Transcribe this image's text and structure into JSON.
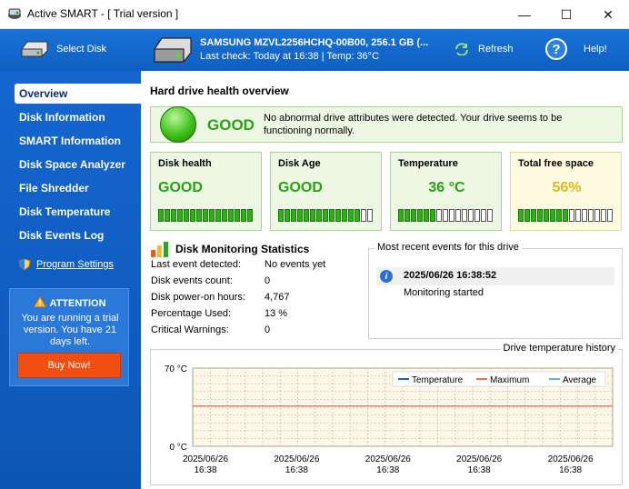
{
  "window": {
    "title": "Active SMART - [ Trial version ]",
    "controls": {
      "minimize": "—",
      "maximize": "☐",
      "close": "✕"
    }
  },
  "toolbar": {
    "select_disk": "Select Disk",
    "drive_name": "SAMSUNG MZVL2256HCHQ-00B00, 256.1 GB (...",
    "drive_check": "Last check: Today at 16:38 | Temp: 36°C",
    "refresh": "Refresh",
    "help": "Help!",
    "help_glyph": "?"
  },
  "sidebar": {
    "items": [
      {
        "label": "Overview",
        "active": true
      },
      {
        "label": "Disk Information"
      },
      {
        "label": "SMART Information"
      },
      {
        "label": "Disk Space Analyzer"
      },
      {
        "label": "File Shredder"
      },
      {
        "label": "Disk Temperature"
      },
      {
        "label": "Disk Events Log"
      }
    ],
    "program_settings": "Program Settings",
    "attention": {
      "title": "ATTENTION",
      "text": "You are running a trial version. You have 21 days left.",
      "buy": "Buy Now!"
    }
  },
  "main": {
    "title": "Hard drive health overview",
    "status": {
      "word": "GOOD",
      "message": "No abnormal drive attributes were detected. Your drive seems to be functioning normally."
    },
    "cards": [
      {
        "title": "Disk health",
        "value": "GOOD",
        "level": 15,
        "segments": 15,
        "style": "good"
      },
      {
        "title": "Disk Age",
        "value": "GOOD",
        "level": 13,
        "segments": 15,
        "style": "good"
      },
      {
        "title": "Temperature",
        "value": "36 °C",
        "level": 6,
        "segments": 15,
        "style": "good"
      },
      {
        "title": "Total free space",
        "value": "56%",
        "level": 8,
        "segments": 15,
        "style": "warn"
      }
    ],
    "stats": {
      "title": "Disk Monitoring Statistics",
      "rows": [
        {
          "label": "Last event detected:",
          "value": "No events yet"
        },
        {
          "label": "Disk events count:",
          "value": "0"
        },
        {
          "label": "Disk power-on hours:",
          "value": "4,767"
        },
        {
          "label": "Percentage Used:",
          "value": "13 %"
        },
        {
          "label": "Critical Warnings:",
          "value": "0"
        }
      ]
    },
    "events": {
      "title": "Most recent events for this drive",
      "date": "2025/06/26 16:38:52",
      "text": "Monitoring started",
      "icon_glyph": "i"
    }
  },
  "chart_data": {
    "type": "line",
    "title": "Drive temperature history",
    "ylabel": "",
    "xlabel": "",
    "ylim": [
      0,
      70
    ],
    "y_ticks": [
      "70 °C",
      "0 °C"
    ],
    "x_ticks": [
      "2025/06/26\n16:38",
      "2025/06/26\n16:38",
      "2025/06/26\n16:38",
      "2025/06/26\n16:38",
      "2025/06/26\n16:38"
    ],
    "legend": [
      "Temperature",
      "Maximum",
      "Average"
    ],
    "legend_placement": "top-right",
    "grid": true,
    "series": [
      {
        "name": "Temperature",
        "values": [],
        "color": "#1f5fbf"
      },
      {
        "name": "Maximum",
        "values": [
          36,
          36
        ],
        "color": "#e07050"
      },
      {
        "name": "Average",
        "values": [],
        "color": "#6aa8e8"
      }
    ],
    "colors": {
      "plot_bg": "#fdf7ea",
      "grid": "#d8ccb0"
    }
  },
  "colors": {
    "accent_blue": "#1466cf",
    "good_green": "#28a212",
    "warn_yellow": "#e0b81a",
    "buy_orange": "#f04e12"
  }
}
